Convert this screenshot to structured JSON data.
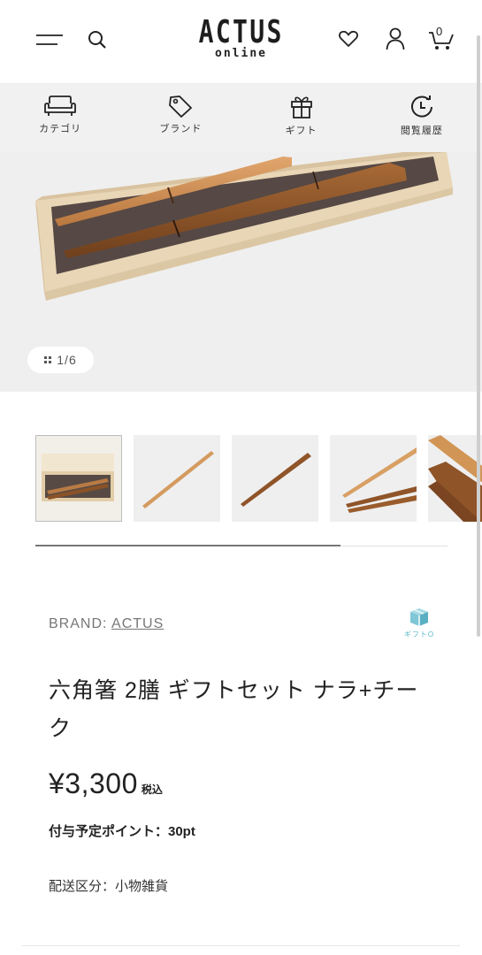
{
  "header": {
    "logo_main": "ACTUS",
    "logo_sub": "online",
    "cart_count": "0",
    "icons": [
      "menu-icon",
      "search-icon",
      "heart-icon",
      "user-icon",
      "cart-icon"
    ]
  },
  "nav": {
    "items": [
      {
        "label": "カテゴリ",
        "icon": "sofa-icon"
      },
      {
        "label": "ブランド",
        "icon": "tag-icon"
      },
      {
        "label": "ギフト",
        "icon": "gift-icon"
      },
      {
        "label": "閲覧履歴",
        "icon": "history-icon"
      }
    ]
  },
  "gallery": {
    "pager": "1/6",
    "thumb_count": 5
  },
  "product": {
    "brand_prefix": "BRAND: ",
    "brand_name": "ACTUS",
    "gift_badge": "ギフトO",
    "title": "六角箸 2膳 ギフトセット ナラ+チーク",
    "price": "¥3,300",
    "tax_label": "税込",
    "points": "付与予定ポイント：30pt",
    "shipping": "配送区分：小物雑貨"
  },
  "colors": {
    "accent_gift": "#5fb8c8",
    "wood_light": "#c98a4e",
    "wood_dark": "#8a5327",
    "box_lining": "#5b4e4a",
    "box_wood": "#ecdcc0"
  }
}
